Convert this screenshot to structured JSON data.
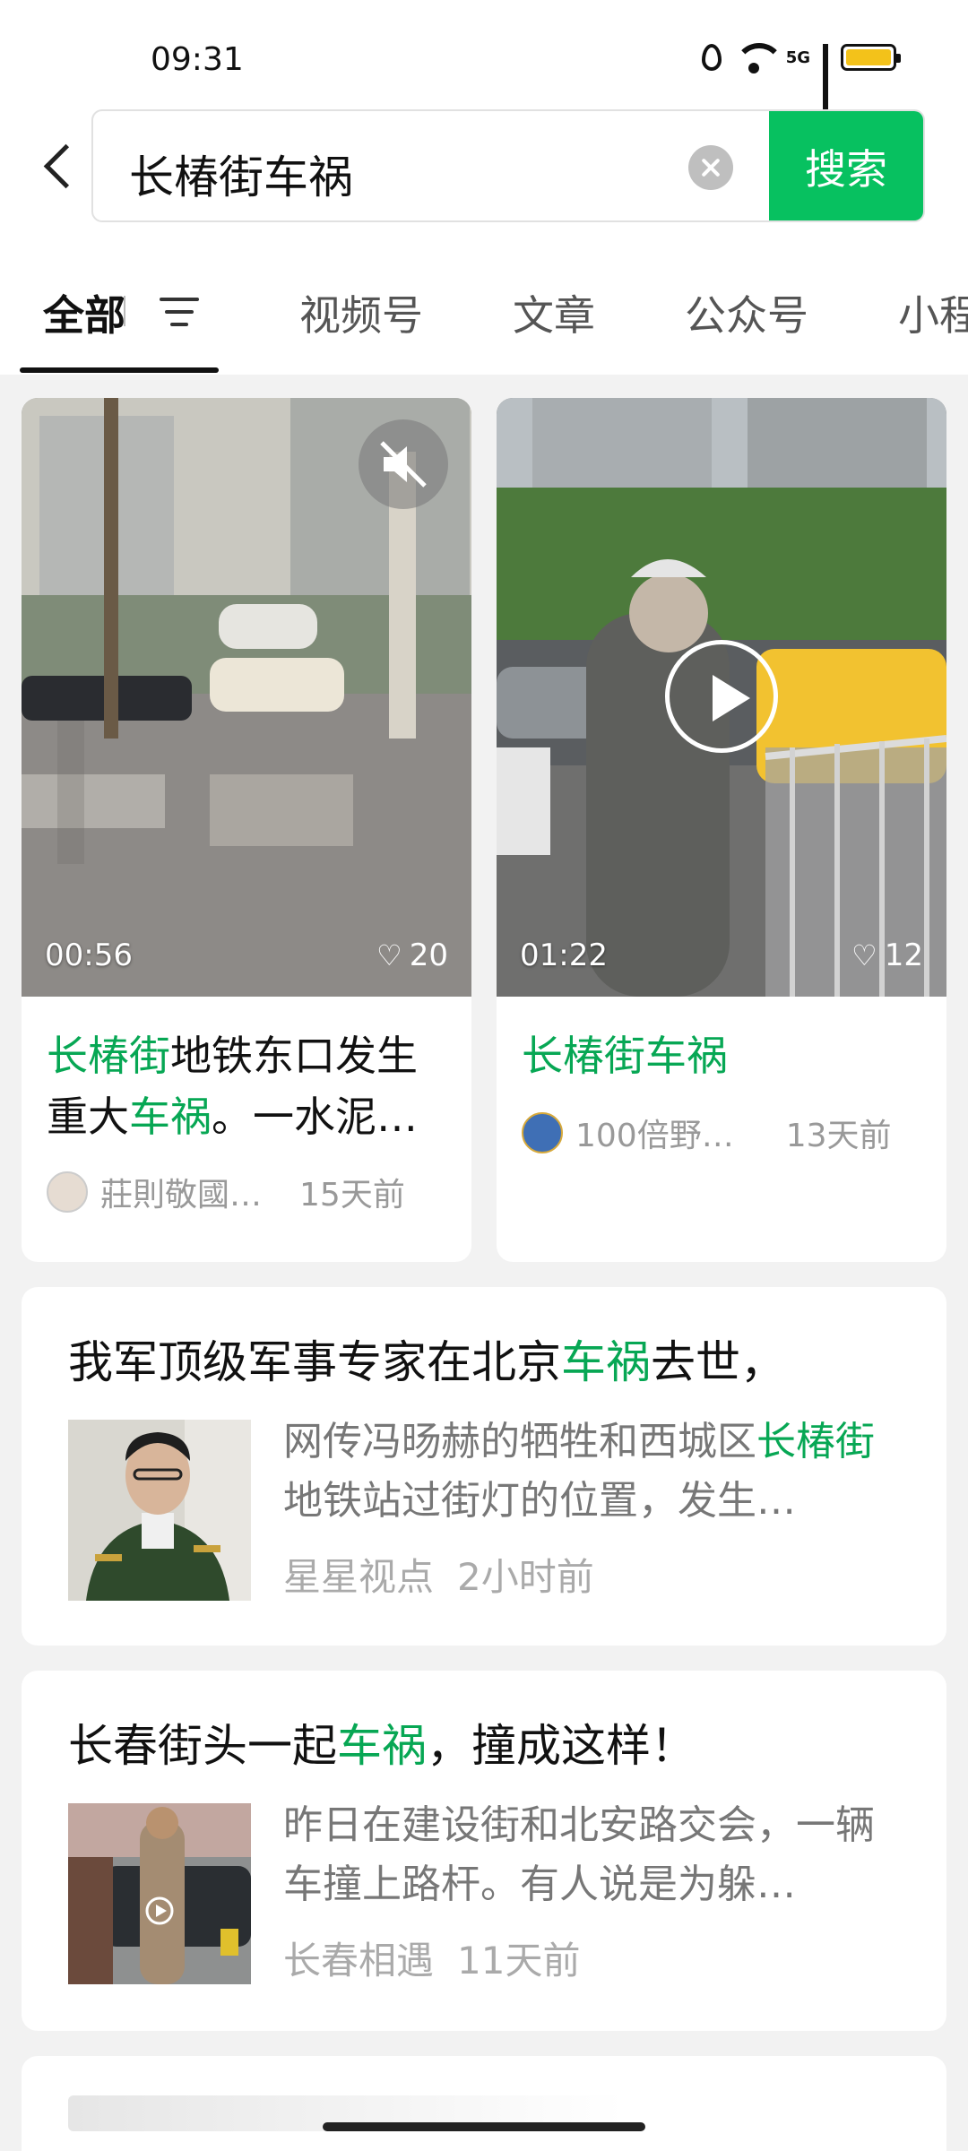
{
  "status_bar": {
    "time": "09:31",
    "network": "5G",
    "colors": {
      "battery": "#f3c21a"
    }
  },
  "search": {
    "query": "长椿街车祸",
    "button_label": "搜索"
  },
  "tabs": [
    {
      "label": "全部"
    },
    {
      "label": "视频号"
    },
    {
      "label": "文章"
    },
    {
      "label": "公众号"
    },
    {
      "label": "小程"
    }
  ],
  "videos": [
    {
      "duration": "00:56",
      "likes": "20",
      "title_hl1": "长椿街",
      "title_mid": "地铁东口发生重大",
      "title_hl2": "车祸",
      "title_end": "。一水泥…",
      "author": "莊則敬國…",
      "time": "15天前",
      "muted": true
    },
    {
      "duration": "01:22",
      "likes": "12",
      "title_hl1": "长椿街车祸",
      "author": "100倍野…",
      "time": "13天前",
      "playable": true
    }
  ],
  "articles": [
    {
      "title_pre": "我军顶级军事专家在北京",
      "title_hl": "车祸",
      "title_post": "去世，",
      "summary_pre": "网传冯旸赫的牺牲和西城区",
      "summary_hl": "长椿街",
      "summary_post": "地铁站过街灯的位置，发生…",
      "source": "星星视点",
      "time": "2小时前"
    },
    {
      "title_pre": "长春街头一起",
      "title_hl": "车祸",
      "title_post": "，撞成这样！",
      "summary": "昨日在建设街和北安路交会，一辆车撞上路杆。有人说是为躲…",
      "source": "长春相遇",
      "time": "11天前"
    }
  ],
  "colors": {
    "accent": "#07c160",
    "highlight": "#07a754"
  }
}
